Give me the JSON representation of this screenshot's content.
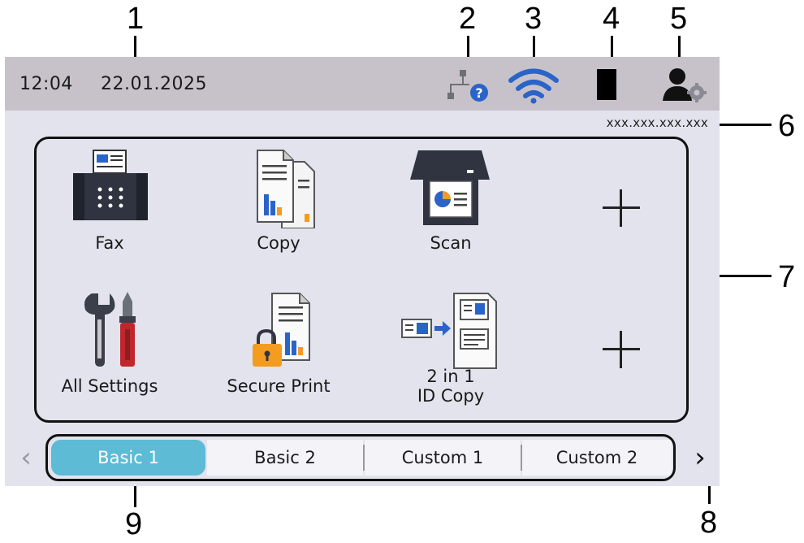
{
  "callouts": [
    "1",
    "2",
    "3",
    "4",
    "5",
    "6",
    "7",
    "8",
    "9"
  ],
  "status": {
    "time": "12:04",
    "date": "22.01.2025"
  },
  "ip_address": "xxx.xxx.xxx.xxx",
  "tiles": [
    {
      "label": "Fax",
      "icon": "fax-icon"
    },
    {
      "label": "Copy",
      "icon": "copy-icon"
    },
    {
      "label": "Scan",
      "icon": "scan-icon"
    },
    {
      "label": "",
      "icon": "add-icon"
    },
    {
      "label": "All Settings",
      "icon": "settings-tools-icon"
    },
    {
      "label": "Secure Print",
      "icon": "secure-print-icon"
    },
    {
      "label": "2 in 1\nID Copy",
      "icon": "id-copy-icon"
    },
    {
      "label": "",
      "icon": "add-icon"
    }
  ],
  "tabs": [
    {
      "label": "Basic 1",
      "active": true
    },
    {
      "label": "Basic 2",
      "active": false
    },
    {
      "label": "Custom 1",
      "active": false
    },
    {
      "label": "Custom 2",
      "active": false
    }
  ],
  "nav": {
    "prev": "‹",
    "next": "›"
  },
  "colors": {
    "statusbar": "#c7c2ca",
    "screen": "#e3e3ee",
    "active_tab": "#5dbbd6",
    "wifi": "#2a64c8",
    "accent_orange": "#f39c1f",
    "accent_red": "#c0272d"
  }
}
